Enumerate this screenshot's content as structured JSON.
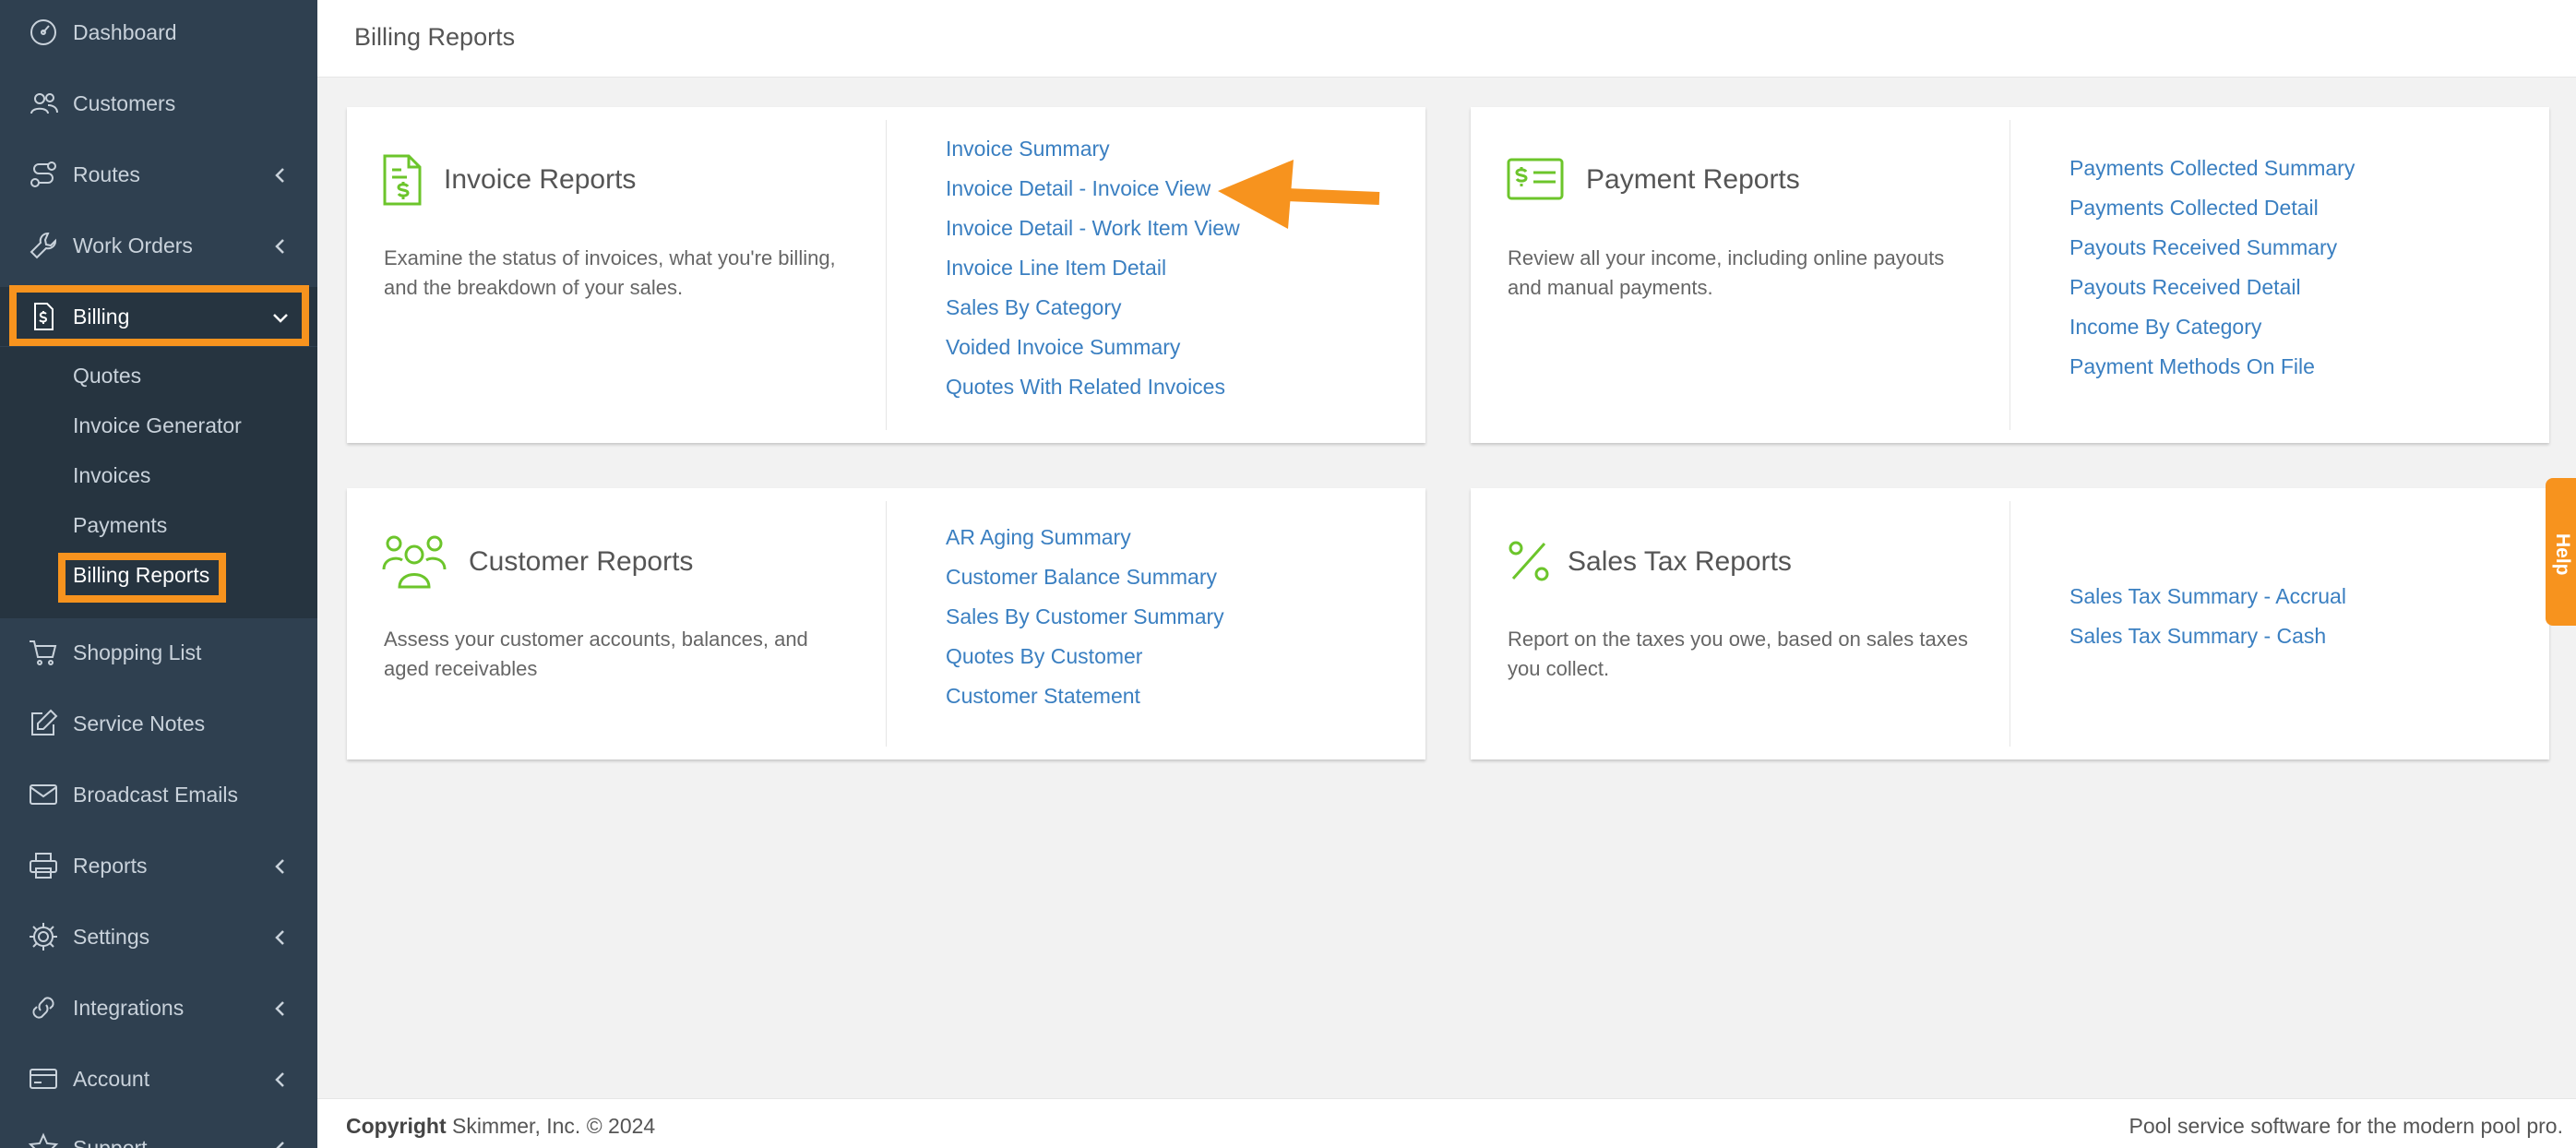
{
  "sidebar": {
    "items": [
      {
        "label": "Dashboard",
        "icon": "dashboard-icon"
      },
      {
        "label": "Customers",
        "icon": "customers-icon"
      },
      {
        "label": "Routes",
        "icon": "routes-icon"
      },
      {
        "label": "Work Orders",
        "icon": "wrench-icon"
      },
      {
        "label": "Billing",
        "icon": "billing-icon"
      },
      {
        "label": "Shopping List",
        "icon": "cart-icon"
      },
      {
        "label": "Service Notes",
        "icon": "edit-icon"
      },
      {
        "label": "Broadcast Emails",
        "icon": "envelope-icon"
      },
      {
        "label": "Reports",
        "icon": "printer-icon"
      },
      {
        "label": "Settings",
        "icon": "gear-icon"
      },
      {
        "label": "Integrations",
        "icon": "link-icon"
      },
      {
        "label": "Account",
        "icon": "credit-card-icon"
      },
      {
        "label": "Support",
        "icon": "star-icon"
      }
    ],
    "billing_submenu": [
      "Quotes",
      "Invoice Generator",
      "Invoices",
      "Payments",
      "Billing Reports"
    ],
    "active_item": "Billing",
    "active_subitem": "Billing Reports"
  },
  "header": {
    "title": "Billing Reports"
  },
  "cards": [
    {
      "title": "Invoice Reports",
      "icon": "invoice-dollar-icon",
      "description": "Examine the status of invoices, what you're billing, and the breakdown of your sales.",
      "links": [
        "Invoice Summary",
        "Invoice Detail - Invoice View",
        "Invoice Detail - Work Item View",
        "Invoice Line Item Detail",
        "Sales By Category",
        "Voided Invoice Summary",
        "Quotes With Related Invoices"
      ]
    },
    {
      "title": "Payment Reports",
      "icon": "money-bill-icon",
      "description": "Review all your income, including online payouts and manual payments.",
      "links": [
        "Payments Collected Summary",
        "Payments Collected Detail",
        "Payouts Received Summary",
        "Payouts Received Detail",
        "Income By Category",
        "Payment Methods On File"
      ]
    },
    {
      "title": "Customer Reports",
      "icon": "users-icon",
      "description": "Assess your customer accounts, balances, and aged receivables",
      "links": [
        "AR Aging Summary",
        "Customer Balance Summary",
        "Sales By Customer Summary",
        "Quotes By Customer",
        "Customer Statement"
      ]
    },
    {
      "title": "Sales Tax Reports",
      "icon": "percent-icon",
      "description": "Report on the taxes you owe, based on sales taxes you collect.",
      "links": [
        "Sales Tax Summary - Accrual",
        "Sales Tax Summary - Cash"
      ]
    }
  ],
  "help_tab": {
    "label": "Help"
  },
  "footer": {
    "copyright_label": "Copyright",
    "copyright_text": "Skimmer, Inc. © 2024",
    "tagline": "Pool service software for the modern pool pro."
  },
  "colors": {
    "sidebar_bg": "#2f4050",
    "accent_orange": "#f7931e",
    "icon_green": "#6cc52b",
    "link_blue": "#3a7fc1"
  }
}
